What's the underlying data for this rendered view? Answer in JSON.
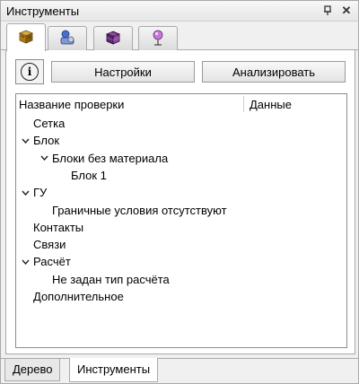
{
  "window": {
    "title": "Инструменты",
    "pin_icon": "pin-icon",
    "close_label": "✕"
  },
  "icon_tabs": [
    {
      "icon": "cube-icon",
      "active": true
    },
    {
      "icon": "assembly-icon",
      "active": false
    },
    {
      "icon": "grid-cube-icon",
      "active": false
    },
    {
      "icon": "probe-icon",
      "active": false
    }
  ],
  "toolbar": {
    "info_label": "i",
    "settings_label": "Настройки",
    "analyze_label": "Анализировать"
  },
  "tree": {
    "col_name": "Название проверки",
    "col_data": "Данные",
    "rows": [
      {
        "label": "Сетка",
        "level": 0,
        "expanded": null
      },
      {
        "label": "Блок",
        "level": 0,
        "expanded": true
      },
      {
        "label": "Блоки без материала",
        "level": 1,
        "expanded": true
      },
      {
        "label": "Блок 1",
        "level": 2,
        "expanded": null
      },
      {
        "label": "ГУ",
        "level": 0,
        "expanded": true
      },
      {
        "label": "Граничные условия отсутствуют",
        "level": 1,
        "expanded": null
      },
      {
        "label": "Контакты",
        "level": 0,
        "expanded": null
      },
      {
        "label": "Связи",
        "level": 0,
        "expanded": null
      },
      {
        "label": "Расчёт",
        "level": 0,
        "expanded": true
      },
      {
        "label": "Не задан тип расчёта",
        "level": 1,
        "expanded": null
      },
      {
        "label": "Дополнительное",
        "level": 0,
        "expanded": null
      }
    ]
  },
  "bottom_tabs": [
    {
      "label": "Дерево",
      "active": false
    },
    {
      "label": "Инструменты",
      "active": true
    }
  ]
}
